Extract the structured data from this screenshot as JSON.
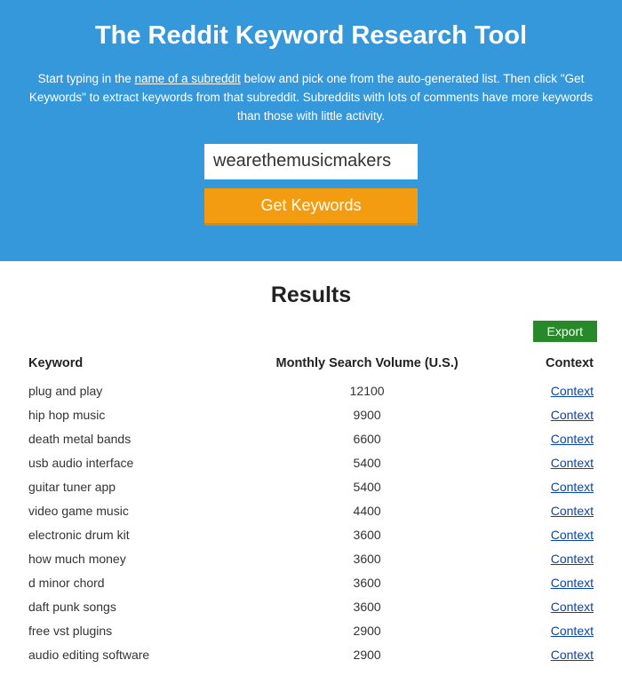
{
  "hero": {
    "title": "The Reddit Keyword Research Tool",
    "desc_before": "Start typing in the ",
    "desc_link": "name of a subreddit",
    "desc_after": " below and pick one from the auto-generated list. Then click \"Get Keywords\" to extract keywords from that subreddit. Subreddits with lots of comments have more keywords than those with little activity.",
    "input_value": "wearethemusicmakers",
    "button_label": "Get Keywords"
  },
  "results": {
    "title": "Results",
    "export_label": "Export",
    "columns": {
      "keyword": "Keyword",
      "volume": "Monthly Search Volume (U.S.)",
      "context": "Context"
    },
    "context_link_label": "Context",
    "rows": [
      {
        "keyword": "plug and play",
        "volume": "12100"
      },
      {
        "keyword": "hip hop music",
        "volume": "9900"
      },
      {
        "keyword": "death metal bands",
        "volume": "6600"
      },
      {
        "keyword": "usb audio interface",
        "volume": "5400"
      },
      {
        "keyword": "guitar tuner app",
        "volume": "5400"
      },
      {
        "keyword": "video game music",
        "volume": "4400"
      },
      {
        "keyword": "electronic drum kit",
        "volume": "3600"
      },
      {
        "keyword": "how much money",
        "volume": "3600"
      },
      {
        "keyword": "d minor chord",
        "volume": "3600"
      },
      {
        "keyword": "daft punk songs",
        "volume": "3600"
      },
      {
        "keyword": "free vst plugins",
        "volume": "2900"
      },
      {
        "keyword": "audio editing software",
        "volume": "2900"
      }
    ]
  }
}
